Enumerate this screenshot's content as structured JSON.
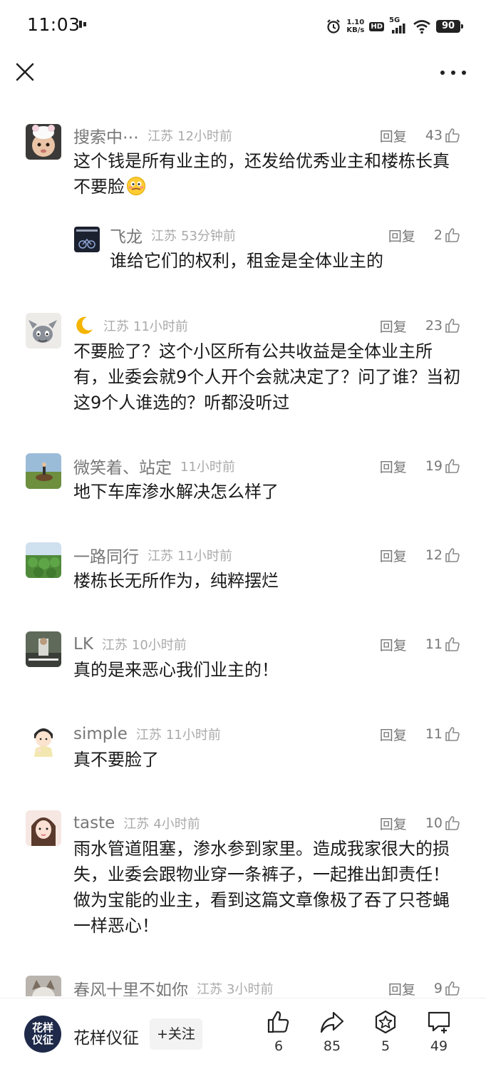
{
  "status": {
    "time": "11:03",
    "net_speed_value": "1.10",
    "net_speed_unit": "KB/s",
    "hd": "HD",
    "signal": "5G",
    "battery": "90"
  },
  "comments": [
    {
      "name": "搜索中⋯",
      "region": "江苏",
      "time": "12小时前",
      "reply_label": "回复",
      "likes": "43",
      "text": "这个钱是所有业主的，还发给优秀业主和楼栋长真不要脸"
    },
    {
      "name": "飞龙",
      "region": "江苏",
      "time": "53分钟前",
      "reply_label": "回复",
      "likes": "2",
      "text": "谁给它们的权利，租金是全体业主的"
    },
    {
      "name": "",
      "region": "江苏",
      "time": "11小时前",
      "reply_label": "回复",
      "likes": "23",
      "text": "不要脸了？这个小区所有公共收益是全体业主所有，业委会就9个人开个会就决定了？问了谁？当初这9个人谁选的？听都没听过"
    },
    {
      "name": "微笑着、站定",
      "region": "",
      "time": "11小时前",
      "reply_label": "回复",
      "likes": "19",
      "text": "地下车库渗水解决怎么样了"
    },
    {
      "name": "一路同行",
      "region": "江苏",
      "time": "11小时前",
      "reply_label": "回复",
      "likes": "12",
      "text": "楼栋长无所作为，纯粹摆烂"
    },
    {
      "name": "LK",
      "region": "江苏",
      "time": "10小时前",
      "reply_label": "回复",
      "likes": "11",
      "text": "真的是来恶心我们业主的！"
    },
    {
      "name": "simple",
      "region": "江苏",
      "time": "11小时前",
      "reply_label": "回复",
      "likes": "11",
      "text": "真不要脸了"
    },
    {
      "name": "taste",
      "region": "江苏",
      "time": "4小时前",
      "reply_label": "回复",
      "likes": "10",
      "text": "雨水管道阻塞，渗水参到家里。造成我家很大的损失，业委会跟物业穿一条裤子，一起推出卸责任！做为宝能的业主，看到这篇文章像极了吞了只苍蝇一样恶心！"
    },
    {
      "name": "春风十里不如你",
      "region": "江苏",
      "time": "3小时前",
      "reply_label": "回复",
      "likes": "9",
      "text": ""
    }
  ],
  "bottom": {
    "author_avatar_line1": "花样",
    "author_avatar_line2": "仪征",
    "author_name": "花样仪征",
    "follow_label": "+关注",
    "like_count": "6",
    "share_count": "85",
    "collect_count": "5",
    "comment_count": "49"
  },
  "colors": {
    "text_primary": "#1a1a1a",
    "text_secondary": "#777777",
    "text_meta": "#aaaaaa",
    "author_avatar_bg": "#1f2a4a"
  }
}
